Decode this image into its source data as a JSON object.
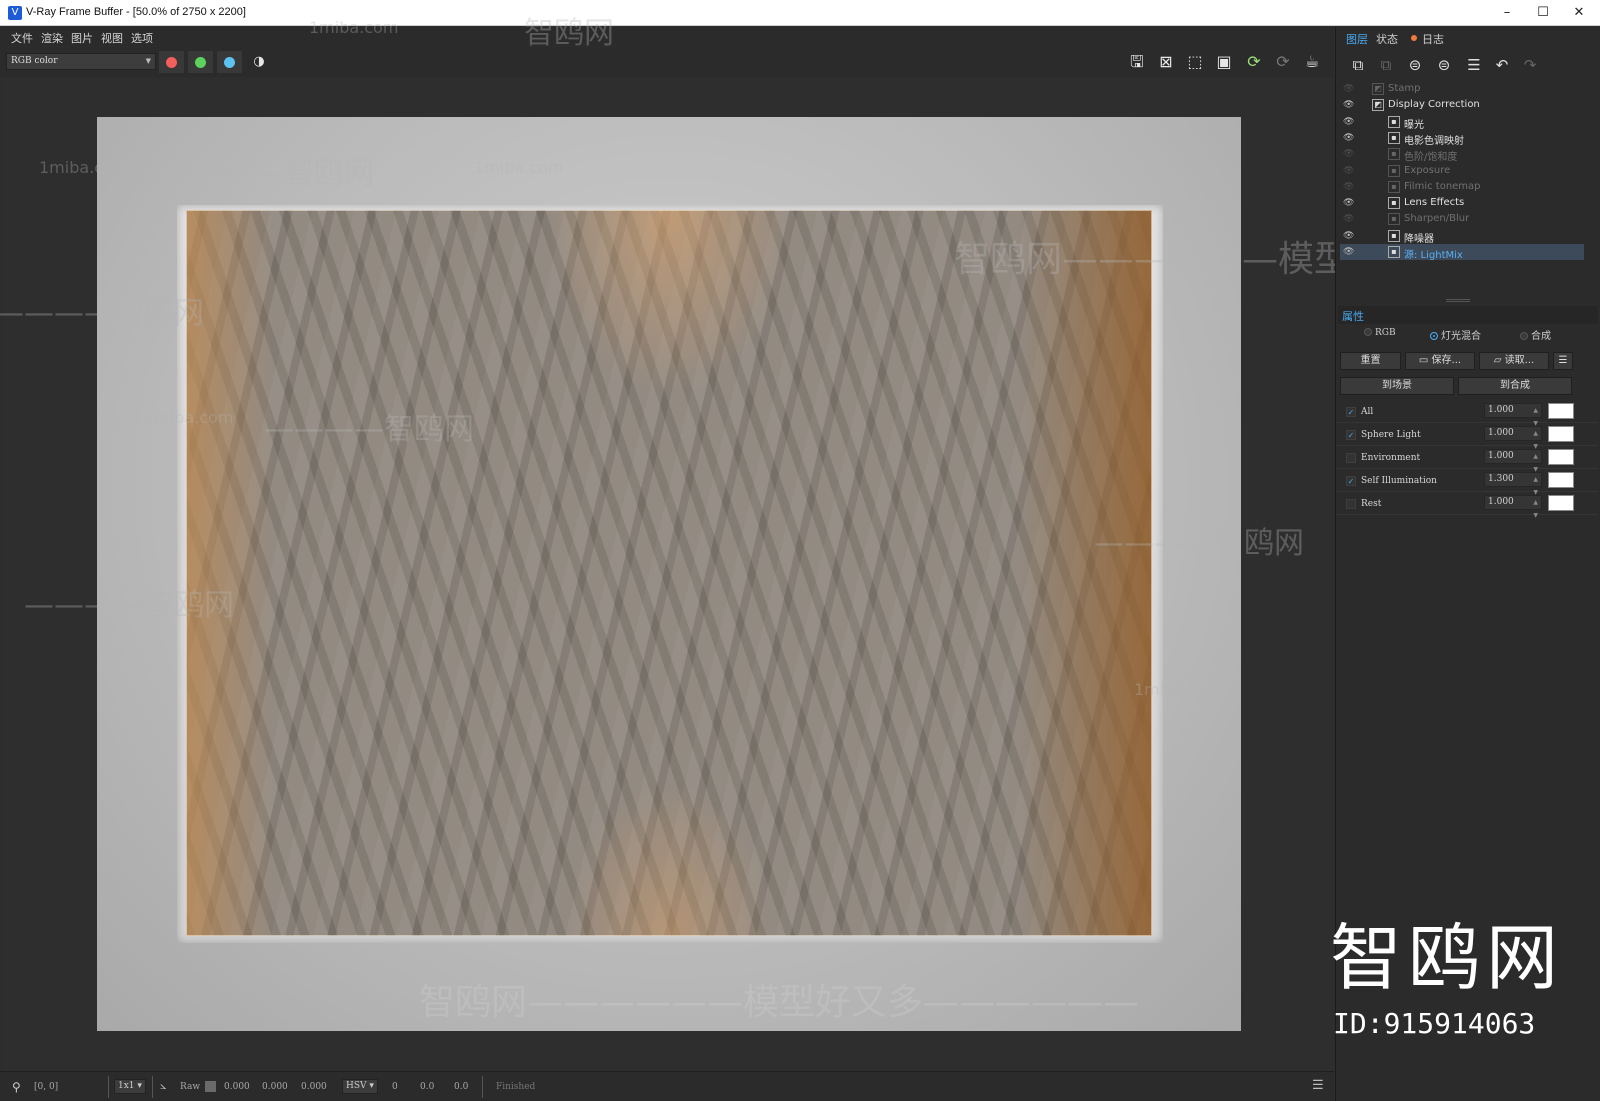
{
  "window": {
    "title": "V-Ray Frame Buffer - [50.0% of 2750 x 2200]",
    "controls": {
      "minimize": "–",
      "maximize": "☐",
      "close": "✕"
    }
  },
  "menu": [
    "文件",
    "渲染",
    "图片",
    "视图",
    "选项"
  ],
  "toolbar": {
    "channel_select": "RGB color",
    "channel_buttons": [
      {
        "name": "red",
        "color": "#f25f5c"
      },
      {
        "name": "green",
        "color": "#5cd25c"
      },
      {
        "name": "blue",
        "color": "#5cc2f2"
      }
    ]
  },
  "watermarks": {
    "site": "1miba.com",
    "brand": "智鸥网",
    "slogan": "智鸥网——————模型好又多——————",
    "dash_brand": "————智鸥网",
    "big_brand": "智鸥网",
    "id": "ID:915914063"
  },
  "status": {
    "coords": "[0, 0]",
    "zoom": "1x1",
    "mode": "Raw",
    "values": [
      "0.000",
      "0.000",
      "0.000"
    ],
    "color_space": "HSV",
    "hsv_values": [
      "0",
      "0.0",
      "0.0"
    ],
    "state": "Finished"
  },
  "panel": {
    "tabs": {
      "layers": "图层",
      "status": "状态",
      "log": "日志"
    },
    "layers": [
      {
        "label": "Stamp",
        "visible": false,
        "dim": true
      },
      {
        "label": "Display Correction",
        "visible": true,
        "dim": false
      },
      {
        "label": "曝光",
        "visible": true,
        "dim": false
      },
      {
        "label": "电影色调映射",
        "visible": true,
        "dim": false
      },
      {
        "label": "色阶/饱和度",
        "visible": false,
        "dim": true
      },
      {
        "label": "Exposure",
        "visible": false,
        "dim": true
      },
      {
        "label": "Filmic tonemap",
        "visible": false,
        "dim": true
      },
      {
        "label": "Lens Effects",
        "visible": true,
        "dim": false
      },
      {
        "label": "Sharpen/Blur",
        "visible": false,
        "dim": true
      },
      {
        "label": "降噪器",
        "visible": true,
        "dim": false
      },
      {
        "label": "源: LightMix",
        "visible": true,
        "dim": false,
        "selected": true
      }
    ],
    "properties_title": "属性",
    "modes": {
      "rgb": "RGB",
      "lightmix": "灯光混合",
      "composite": "合成"
    },
    "buttons": {
      "reset": "重置",
      "save": "保存...",
      "load": "读取...",
      "to_scene": "到场景",
      "to_composite": "到合成"
    },
    "lightmix": [
      {
        "name": "All",
        "checked": true,
        "value": "1.000"
      },
      {
        "name": "Sphere Light",
        "checked": true,
        "value": "1.000"
      },
      {
        "name": "Environment",
        "checked": false,
        "value": "1.000"
      },
      {
        "name": "Self Illumination",
        "checked": true,
        "value": "1.300"
      },
      {
        "name": "Rest",
        "checked": false,
        "value": "1.000"
      }
    ]
  }
}
